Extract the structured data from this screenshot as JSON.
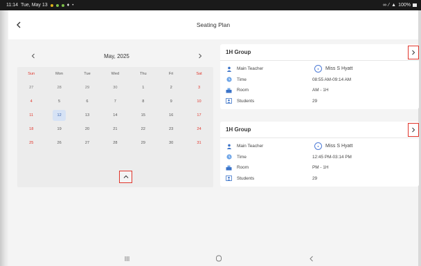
{
  "status_bar": {
    "time": "11:14",
    "date": "Tue, May 13",
    "battery": "100%"
  },
  "app_bar": {
    "title": "Seating Plan"
  },
  "calendar": {
    "month_label": "May, 2025",
    "weekdays": [
      "Sun",
      "Mon",
      "Tue",
      "Wed",
      "Thu",
      "Fri",
      "Sat"
    ],
    "weeks": [
      [
        "27",
        "28",
        "29",
        "30",
        "1",
        "2",
        "3"
      ],
      [
        "4",
        "5",
        "6",
        "7",
        "8",
        "9",
        "10"
      ],
      [
        "11",
        "12",
        "13",
        "14",
        "15",
        "16",
        "17"
      ],
      [
        "18",
        "19",
        "20",
        "21",
        "22",
        "23",
        "24"
      ],
      [
        "25",
        "26",
        "27",
        "28",
        "29",
        "30",
        "31"
      ]
    ],
    "selected_day": "12",
    "accent_color": "#e0342a",
    "selected_color": "#d6e2f5"
  },
  "groups": [
    {
      "name": "1H Group",
      "rows": [
        {
          "label": "Main Teacher",
          "value": "Miss S Hyatt",
          "icon": "teacher-icon"
        },
        {
          "label": "Time",
          "value": "08:55 AM-09:14 AM",
          "icon": "clock-icon"
        },
        {
          "label": "Room",
          "value": "AM - 1H",
          "icon": "room-icon"
        },
        {
          "label": "Students",
          "value": "29",
          "icon": "students-icon"
        }
      ]
    },
    {
      "name": "1H Group",
      "rows": [
        {
          "label": "Main Teacher",
          "value": "Miss S Hyatt",
          "icon": "teacher-icon"
        },
        {
          "label": "Time",
          "value": "12:45 PM-03:14 PM",
          "icon": "clock-icon"
        },
        {
          "label": "Room",
          "value": "PM - 1H",
          "icon": "room-icon"
        },
        {
          "label": "Students",
          "value": "29",
          "icon": "students-icon"
        }
      ]
    }
  ]
}
